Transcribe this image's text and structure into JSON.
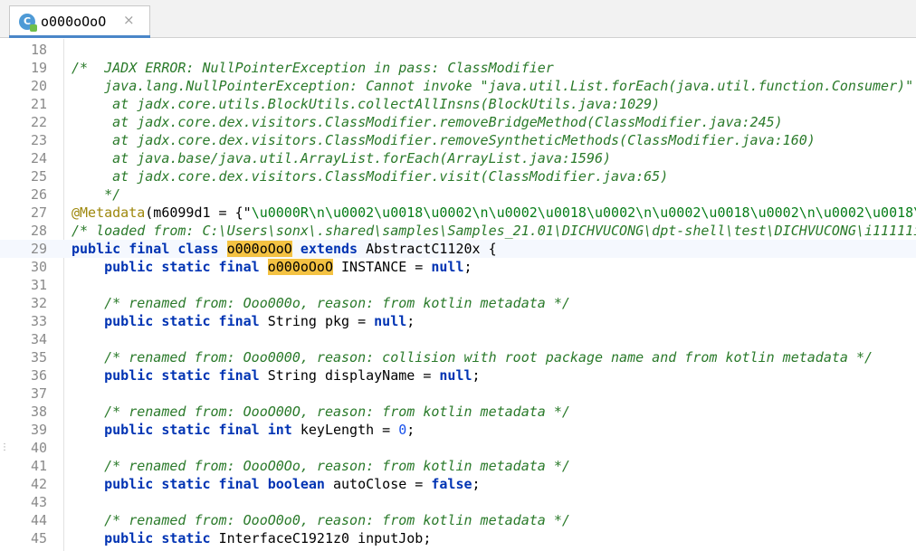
{
  "tab": {
    "icon_letter": "C",
    "title": "o000oOoO",
    "close": "×"
  },
  "lines": [
    {
      "n": "18",
      "parts": []
    },
    {
      "n": "19",
      "parts": [
        {
          "t": "/*  JADX ERROR: NullPointerException in pass: ClassModifier",
          "c": "cmt"
        }
      ]
    },
    {
      "n": "20",
      "parts": [
        {
          "t": "    java.lang.NullPointerException: Cannot invoke \"java.util.List.forEach(java.util.function.Consumer)\"",
          "c": "cmt"
        }
      ]
    },
    {
      "n": "21",
      "parts": [
        {
          "t": "     at jadx.core.utils.BlockUtils.collectAllInsns(BlockUtils.java:1029)",
          "c": "cmt"
        }
      ]
    },
    {
      "n": "22",
      "parts": [
        {
          "t": "     at jadx.core.dex.visitors.ClassModifier.removeBridgeMethod(ClassModifier.java:245)",
          "c": "cmt"
        }
      ]
    },
    {
      "n": "23",
      "parts": [
        {
          "t": "     at jadx.core.dex.visitors.ClassModifier.removeSyntheticMethods(ClassModifier.java:160)",
          "c": "cmt"
        }
      ]
    },
    {
      "n": "24",
      "parts": [
        {
          "t": "     at java.base/java.util.ArrayList.forEach(ArrayList.java:1596)",
          "c": "cmt"
        }
      ]
    },
    {
      "n": "25",
      "parts": [
        {
          "t": "     at jadx.core.dex.visitors.ClassModifier.visit(ClassModifier.java:65)",
          "c": "cmt"
        }
      ]
    },
    {
      "n": "26",
      "parts": [
        {
          "t": "    */",
          "c": "cmt"
        }
      ]
    },
    {
      "n": "27",
      "parts": [
        {
          "t": "@Metadata",
          "c": "ann"
        },
        {
          "t": "(m6099d1 = {\"",
          "c": ""
        },
        {
          "t": "\\u0000R\\n\\u0002\\u0018\\u0002\\n\\u0002\\u0018\\u0002\\n\\u0002\\u0018\\u0002\\n\\u0002\\u0018\\",
          "c": "str"
        }
      ]
    },
    {
      "n": "28",
      "parts": [
        {
          "t": "/* loaded from: C:\\Users\\sonx\\.shared\\samples\\Samples_21.01\\DICHVUCONG\\dpt-shell\\test\\DICHVUCONG\\i11111i",
          "c": "cmt"
        }
      ]
    },
    {
      "n": "29",
      "current": true,
      "parts": [
        {
          "t": "public final class ",
          "c": "kw"
        },
        {
          "t": "",
          "c": "caret"
        },
        {
          "t": "o000oOoO",
          "c": "hl"
        },
        {
          "t": " ",
          "c": ""
        },
        {
          "t": "extends",
          "c": "kw"
        },
        {
          "t": " AbstractC1120x {",
          "c": ""
        }
      ]
    },
    {
      "n": "30",
      "parts": [
        {
          "t": "    ",
          "c": ""
        },
        {
          "t": "public static final ",
          "c": "kw"
        },
        {
          "t": "o000oOoO",
          "c": "hl"
        },
        {
          "t": " INSTANCE = ",
          "c": ""
        },
        {
          "t": "null",
          "c": "kw"
        },
        {
          "t": ";",
          "c": ""
        }
      ]
    },
    {
      "n": "31",
      "parts": []
    },
    {
      "n": "32",
      "parts": [
        {
          "t": "    /* renamed from: Ooo000o, reason: from kotlin metadata */",
          "c": "cmt"
        }
      ]
    },
    {
      "n": "33",
      "parts": [
        {
          "t": "    ",
          "c": ""
        },
        {
          "t": "public static final ",
          "c": "kw"
        },
        {
          "t": "String pkg = ",
          "c": ""
        },
        {
          "t": "null",
          "c": "kw"
        },
        {
          "t": ";",
          "c": ""
        }
      ]
    },
    {
      "n": "34",
      "parts": []
    },
    {
      "n": "35",
      "parts": [
        {
          "t": "    /* renamed from: Ooo0000, reason: collision with root package name and from kotlin metadata */",
          "c": "cmt"
        }
      ]
    },
    {
      "n": "36",
      "parts": [
        {
          "t": "    ",
          "c": ""
        },
        {
          "t": "public static final ",
          "c": "kw"
        },
        {
          "t": "String displayName = ",
          "c": ""
        },
        {
          "t": "null",
          "c": "kw"
        },
        {
          "t": ";",
          "c": ""
        }
      ]
    },
    {
      "n": "37",
      "parts": []
    },
    {
      "n": "38",
      "parts": [
        {
          "t": "    /* renamed from: OooO00O, reason: from kotlin metadata */",
          "c": "cmt"
        }
      ]
    },
    {
      "n": "39",
      "parts": [
        {
          "t": "    ",
          "c": ""
        },
        {
          "t": "public static final ",
          "c": "kw"
        },
        {
          "t": "int",
          "c": "type"
        },
        {
          "t": " keyLength = ",
          "c": ""
        },
        {
          "t": "0",
          "c": "num"
        },
        {
          "t": ";",
          "c": ""
        }
      ]
    },
    {
      "n": "40",
      "parts": []
    },
    {
      "n": "41",
      "parts": [
        {
          "t": "    /* renamed from: OooO0Oo, reason: from kotlin metadata */",
          "c": "cmt"
        }
      ]
    },
    {
      "n": "42",
      "parts": [
        {
          "t": "    ",
          "c": ""
        },
        {
          "t": "public static final ",
          "c": "kw"
        },
        {
          "t": "boolean",
          "c": "type"
        },
        {
          "t": " autoClose = ",
          "c": ""
        },
        {
          "t": "false",
          "c": "kw"
        },
        {
          "t": ";",
          "c": ""
        }
      ]
    },
    {
      "n": "43",
      "parts": []
    },
    {
      "n": "44",
      "parts": [
        {
          "t": "    /* renamed from: OooO0o0, reason: from kotlin metadata */",
          "c": "cmt"
        }
      ]
    },
    {
      "n": "45",
      "parts": [
        {
          "t": "    ",
          "c": ""
        },
        {
          "t": "public static ",
          "c": "kw"
        },
        {
          "t": "InterfaceC1921z0 inputJob;",
          "c": ""
        }
      ]
    }
  ]
}
